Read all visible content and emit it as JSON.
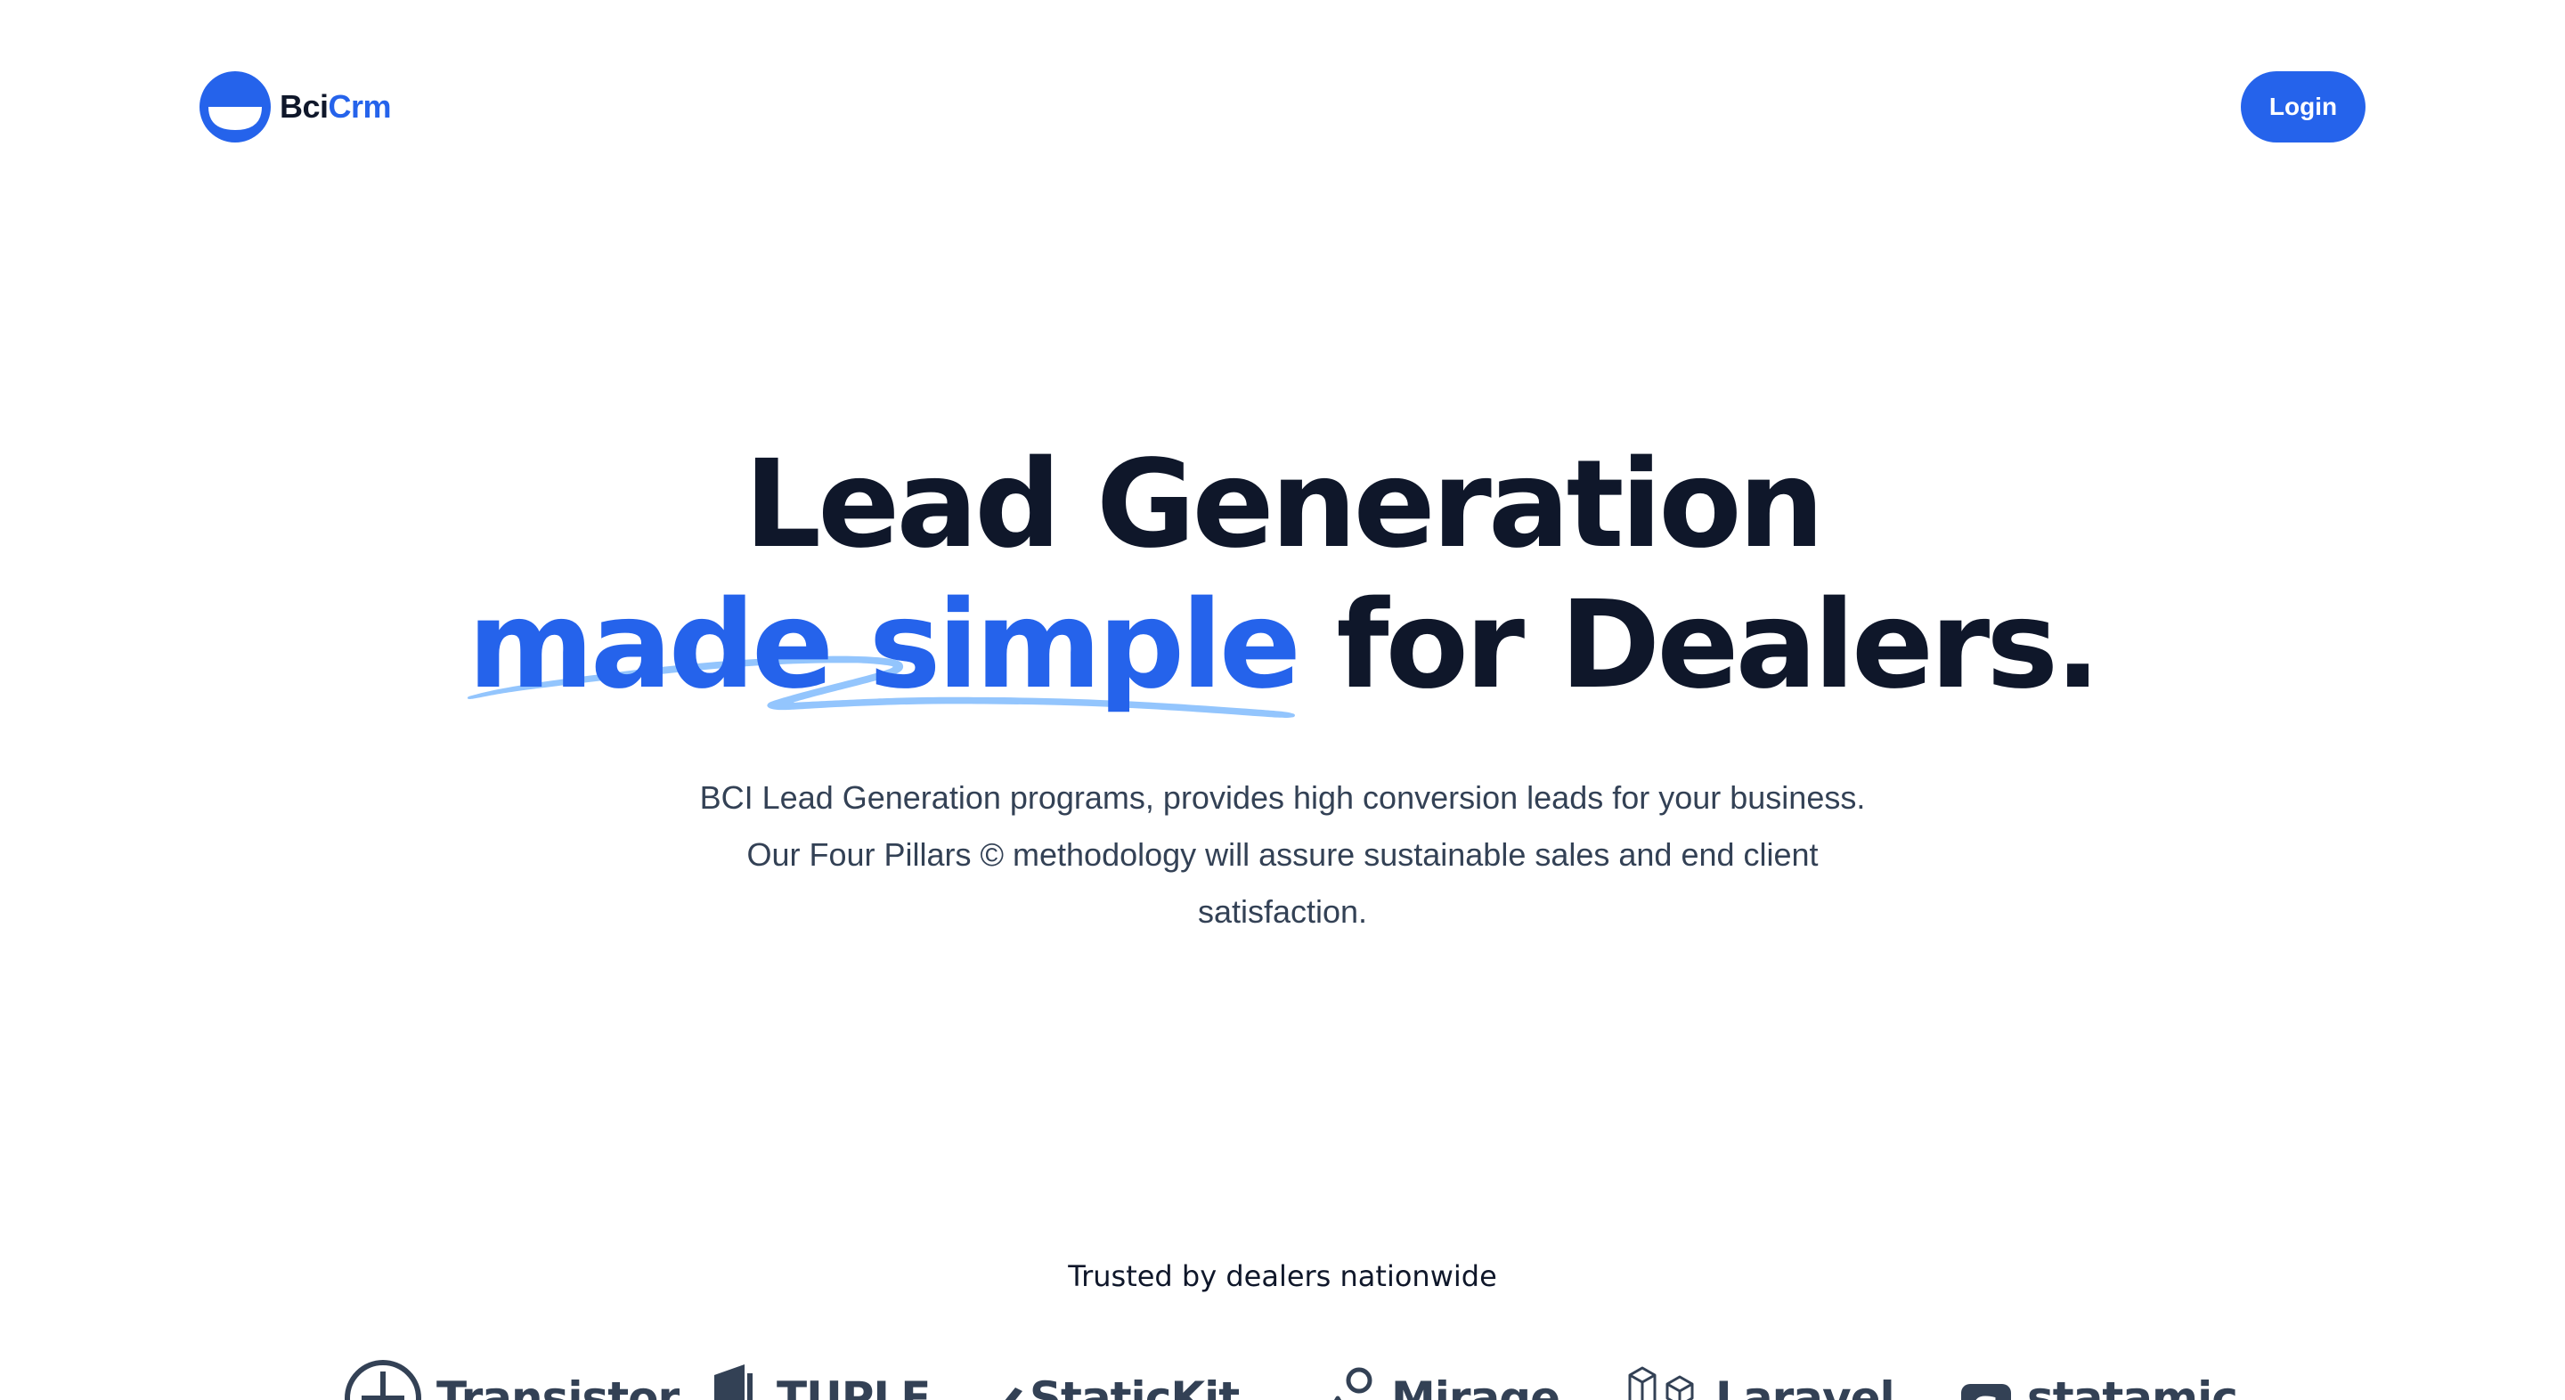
{
  "header": {
    "logo_text_primary": "Bci",
    "logo_text_accent": "Crm",
    "login_label": "Login"
  },
  "hero": {
    "title_line1": "Lead Generation",
    "title_accent": "made simple",
    "title_rest": " for Dealers.",
    "description": "BCI Lead Generation programs, provides high conversion leads for your business. Our Four Pillars © methodology will assure sustainable sales and end client satisfaction."
  },
  "trusted": {
    "heading": "Trusted by dealers nationwide",
    "brands": [
      {
        "name": "Transistor",
        "icon": "transistor-icon"
      },
      {
        "name": "TUPLE",
        "icon": "tuple-icon"
      },
      {
        "name": "StaticKit",
        "icon": "statickit-icon"
      },
      {
        "name": "Mirage",
        "icon": "mirage-icon"
      },
      {
        "name": "Laravel",
        "icon": "laravel-icon"
      },
      {
        "name": "statamic",
        "icon": "statamic-icon"
      }
    ]
  },
  "colors": {
    "accent": "#2563eb",
    "heading": "#0f172a",
    "body_text": "#334155",
    "squiggle": "#93c5fd"
  }
}
